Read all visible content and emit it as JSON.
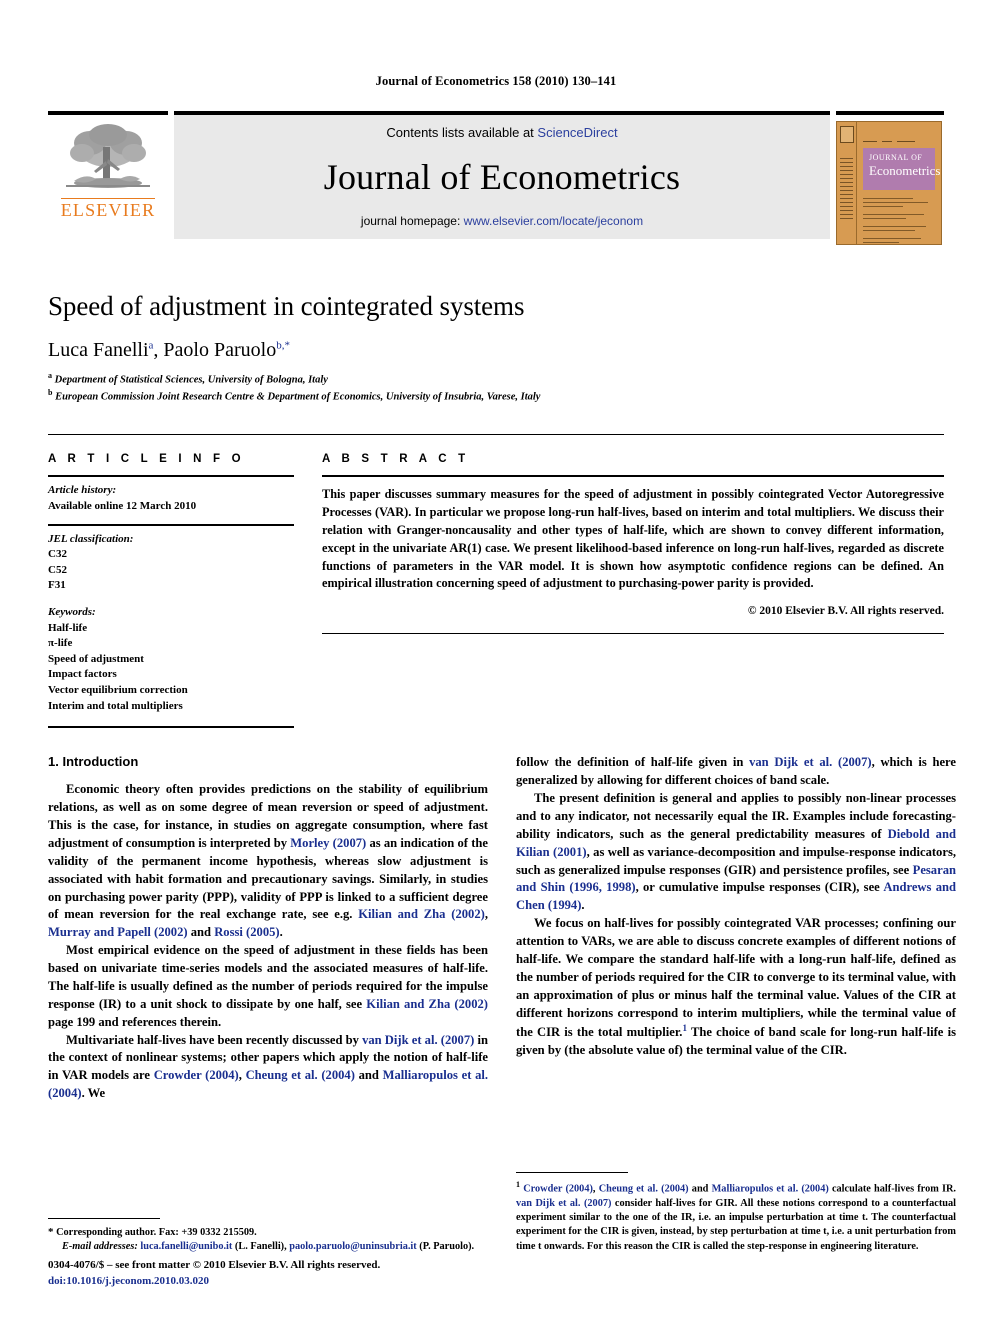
{
  "running_head": "Journal of Econometrics 158 (2010) 130–141",
  "masthead": {
    "publisher_name": "ELSEVIER",
    "contents_prefix": "Contents lists available at ",
    "contents_link": "ScienceDirect",
    "journal_name": "Journal of Econometrics",
    "homepage_prefix": "journal homepage: ",
    "homepage_url": "www.elsevier.com/locate/jeconom",
    "cover": {
      "line1": "JOURNAL OF",
      "line2": "Econometrics"
    }
  },
  "article": {
    "title": "Speed of adjustment in cointegrated systems",
    "authors": "Luca Fanelli, Paolo Paruolo",
    "author1_name": "Luca Fanelli",
    "author1_mark": "a",
    "author2_name": "Paolo Paruolo",
    "author2_mark": "b,",
    "author2_star": "*",
    "affiliation_a_mark": "a",
    "affiliation_a": "Department of Statistical Sciences, University of Bologna, Italy",
    "affiliation_b_mark": "b",
    "affiliation_b": "European Commission Joint Research Centre & Department of Economics, University of Insubria, Varese, Italy"
  },
  "info": {
    "heading": "A R T I C L E   I N F O",
    "history_label": "Article history:",
    "history_value": "Available online 12 March 2010",
    "jel_label": "JEL classification:",
    "jel_codes": [
      "C32",
      "C52",
      "F31"
    ],
    "keywords_label": "Keywords:",
    "keywords": [
      "Half-life",
      "π-life",
      "Speed of adjustment",
      "Impact factors",
      "Vector equilibrium correction",
      "Interim and total multipliers"
    ]
  },
  "abstract": {
    "heading": "A B S T R A C T",
    "text": "This paper discusses summary measures for the speed of adjustment in possibly cointegrated Vector Autoregressive Processes (VAR). In particular we propose long-run half-lives, based on interim and total multipliers. We discuss their relation with Granger-noncausality and other types of half-life, which are shown to convey different information, except in the univariate AR(1) case. We present likelihood-based inference on long-run half-lives, regarded as discrete functions of parameters in the VAR model. It is shown how asymptotic confidence regions can be defined. An empirical illustration concerning speed of adjustment to purchasing-power parity is provided.",
    "copyright": "© 2010 Elsevier B.V. All rights reserved."
  },
  "body": {
    "section_heading": "1. Introduction",
    "left": {
      "p1_a": "Economic theory often provides predictions on the stability of equilibrium relations, as well as on some degree of mean reversion or speed of adjustment. This is the case, for instance, in studies on aggregate consumption, where fast adjustment of consumption is interpreted by ",
      "p1_cite1": "Morley (2007)",
      "p1_b": " as an indication of the validity of the permanent income hypothesis, whereas slow adjustment is associated with habit formation and precautionary savings. Similarly, in studies on purchasing power parity (PPP), validity of PPP is linked to a sufficient degree of mean reversion for the real exchange rate, see e.g. ",
      "p1_cite2": "Kilian and Zha (2002)",
      "p1_c": ", ",
      "p1_cite3": "Murray and Papell (2002)",
      "p1_d": " and ",
      "p1_cite4": "Rossi (2005)",
      "p1_e": ".",
      "p2_a": "Most empirical evidence on the speed of adjustment in these fields has been based on univariate time-series models and the associated measures of half-life. The half-life is usually defined as the number of periods required for the impulse response (IR) to a unit shock to dissipate by one half, see ",
      "p2_cite1": "Kilian and Zha (2002)",
      "p2_b": " page 199 and references therein.",
      "p3_a": "Multivariate half-lives have been recently discussed by ",
      "p3_cite1": "van Dijk et al. (2007)",
      "p3_b": " in the context of nonlinear systems; other papers which apply the notion of half-life in VAR models are ",
      "p3_cite2": "Crowder (2004)",
      "p3_c": ", ",
      "p3_cite3": "Cheung et al. (2004)",
      "p3_d": " and ",
      "p3_cite4": "Malliaropulos et al. (2004)",
      "p3_e": ". We"
    },
    "right": {
      "p1_a": "follow the definition of half-life given in ",
      "p1_cite1": "van Dijk et al. (2007)",
      "p1_b": ", which is here generalized by allowing for different choices of band scale.",
      "p2_a": "The present definition is general and applies to possibly non-linear processes and to any indicator, not necessarily equal the IR. Examples include forecasting-ability indicators, such as the general predictability measures of ",
      "p2_cite1": "Diebold and Kilian (2001)",
      "p2_b": ", as well as variance-decomposition and impulse-response indicators, such as generalized impulse responses (GIR) and persistence profiles, see ",
      "p2_cite2": "Pesaran and Shin (1996, 1998)",
      "p2_c": ", or cumulative impulse responses (CIR), see ",
      "p2_cite3": "Andrews and Chen (1994)",
      "p2_d": ".",
      "p3_a": "We focus on half-lives for possibly cointegrated VAR processes; confining our attention to VARs, we are able to discuss concrete examples of different notions of half-life. We compare the standard half-life with a long-run half-life, defined as the number of periods required for the CIR to converge to its terminal value, with an approximation of plus or minus half the terminal value. Values of the CIR at different horizons correspond to interim multipliers, while the terminal value of the CIR is the total multiplier.",
      "p3_fnmark": "1",
      "p3_b": " The choice of band scale for long-run half-life is given by (the absolute value of) the terminal value of the CIR."
    }
  },
  "footnotes": {
    "left_star": "*",
    "left_corresponding": " Corresponding author. Fax: +39 0332 215509.",
    "left_email_label": "E-mail addresses:",
    "left_email1": "luca.fanelli@unibo.it",
    "left_email1_who": " (L. Fanelli), ",
    "left_email2": "paolo.paruolo@uninsubria.it",
    "left_email2_who": " (P. Paruolo).",
    "right_mark": "1",
    "right_a": " ",
    "right_cite1": "Crowder (2004)",
    "right_b": ", ",
    "right_cite2": "Cheung et al. (2004)",
    "right_c": " and ",
    "right_cite3": "Malliaropulos et al. (2004)",
    "right_d": " calculate half-lives from IR. ",
    "right_cite4": "van Dijk et al. (2007)",
    "right_e": " consider half-lives for GIR. All these notions correspond to a counterfactual experiment similar to the one of the IR, i.e. an impulse perturbation at time t. The counterfactual experiment for the CIR is given, instead, by step perturbation at time t, i.e. a unit perturbation from time t onwards. For this reason the CIR is called the step-response in engineering literature."
  },
  "imprint": {
    "line1": "0304-4076/$ – see front matter © 2010 Elsevier B.V. All rights reserved.",
    "doi": "doi:10.1016/j.jeconom.2010.03.020"
  },
  "colors": {
    "link": "#1a2f8f",
    "elsevier_orange": "#E87B1E",
    "cover_orange": "#D79B52",
    "cover_purple": "#B07CAE"
  }
}
